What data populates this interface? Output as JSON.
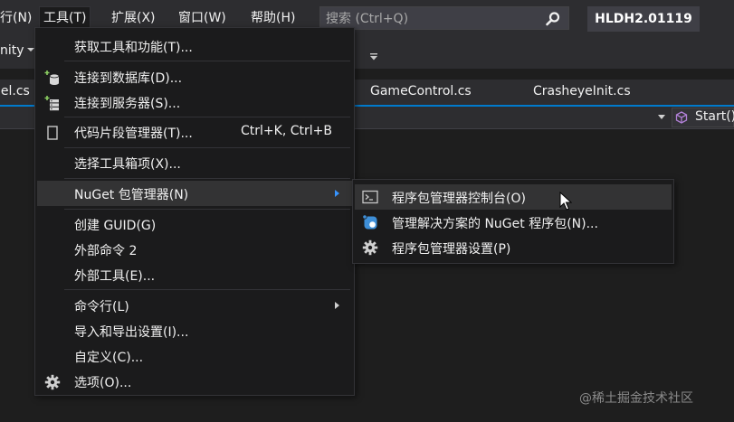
{
  "menubar": {
    "items": [
      {
        "label": "行(N)"
      },
      {
        "label": "工具(T)"
      },
      {
        "label": "扩展(X)"
      },
      {
        "label": "窗口(W)"
      },
      {
        "label": "帮助(H)"
      }
    ],
    "search_placeholder": "搜索 (Ctrl+Q)",
    "title_badge": "HLDH2.01119"
  },
  "toolbar": {
    "left_text": "nity"
  },
  "tabs": [
    {
      "label": "nel.cs"
    },
    {
      "label": "GameControl.cs"
    },
    {
      "label": "CrasheyeInit.cs"
    }
  ],
  "navbar": {
    "member_label": "Start()"
  },
  "tools_menu": {
    "items": [
      {
        "label": "获取工具和功能(T)..."
      },
      {
        "label": "连接到数据库(D)..."
      },
      {
        "label": "连接到服务器(S)..."
      },
      {
        "label": "代码片段管理器(T)...",
        "shortcut": "Ctrl+K, Ctrl+B"
      },
      {
        "label": "选择工具箱项(X)..."
      },
      {
        "label": "NuGet 包管理器(N)"
      },
      {
        "label": "创建 GUID(G)"
      },
      {
        "label": "外部命令 2"
      },
      {
        "label": "外部工具(E)..."
      },
      {
        "label": "命令行(L)"
      },
      {
        "label": "导入和导出设置(I)..."
      },
      {
        "label": "自定义(C)..."
      },
      {
        "label": "选项(O)..."
      }
    ]
  },
  "nuget_submenu": {
    "items": [
      {
        "label": "程序包管理器控制台(O)"
      },
      {
        "label": "管理解决方案的 NuGet 程序包(N)..."
      },
      {
        "label": "程序包管理器设置(P)"
      }
    ]
  },
  "watermark": "@稀土掘金技术社区",
  "colors": {
    "background": "#1e1e1e",
    "chrome": "#2d2d30",
    "menu_bg": "#1b1b1c",
    "highlight": "#333334",
    "accent": "#007acc"
  }
}
